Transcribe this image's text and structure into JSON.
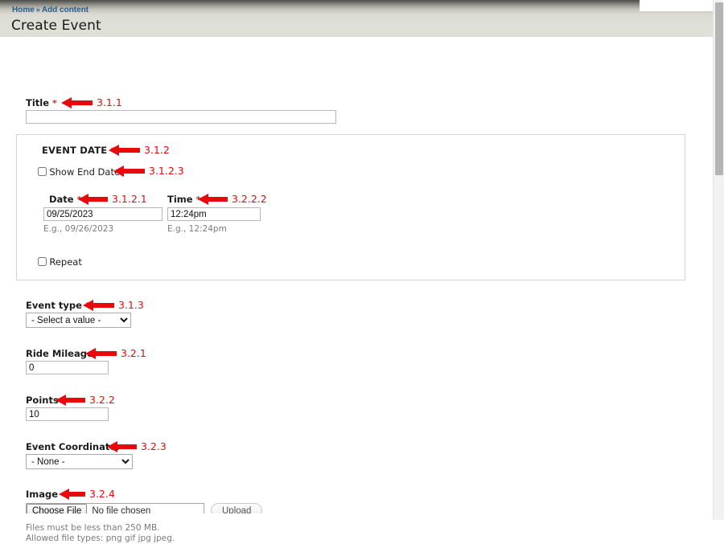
{
  "breadcrumb": {
    "home": "Home",
    "separator": "»",
    "current": "Add content"
  },
  "page": {
    "title": "Create Event"
  },
  "colors": {
    "annotation": "#e8090d",
    "required_asterisk": "#c0392b",
    "breadcrumb_link": "#2a5d8f",
    "header_band": "#dfe0d7"
  },
  "form": {
    "title_field": {
      "label": "Title",
      "required_mark": "*",
      "value": "",
      "annotation": "3.1.1"
    },
    "event_date": {
      "legend": "EVENT DATE",
      "required_mark": "*",
      "annotation": "3.1.2",
      "show_end_date": {
        "label": "Show End Date",
        "checked": false,
        "annotation": "3.1.2.3"
      },
      "date": {
        "label": "Date",
        "required_mark": "*",
        "value": "09/25/2023",
        "hint": "E.g., 09/26/2023",
        "annotation": "3.1.2.1"
      },
      "time": {
        "label": "Time",
        "required_mark": "*",
        "value": "12:24pm",
        "hint": "E.g., 12:24pm",
        "annotation": "3.2.2.2"
      },
      "repeat": {
        "label": "Repeat",
        "checked": false
      }
    },
    "event_type": {
      "label": "Event type",
      "required_mark": "*",
      "selected": "- Select a value -",
      "annotation": "3.1.3"
    },
    "ride_mileage": {
      "label": "Ride Mileage",
      "value": "0",
      "annotation": "3.2.1"
    },
    "points": {
      "label": "Points",
      "value": "10",
      "annotation": "3.2.2"
    },
    "event_coordinator": {
      "label": "Event Coordinator",
      "selected": "- None -",
      "annotation": "3.2.3"
    },
    "image": {
      "label": "Image",
      "annotation": "3.2.4",
      "choose_file_label": "Choose File",
      "no_file_text": "No file chosen",
      "upload_label": "Upload",
      "hint_line1": "Files must be less than 250 MB.",
      "hint_line2": "Allowed file types: png gif jpg jpeg."
    }
  }
}
